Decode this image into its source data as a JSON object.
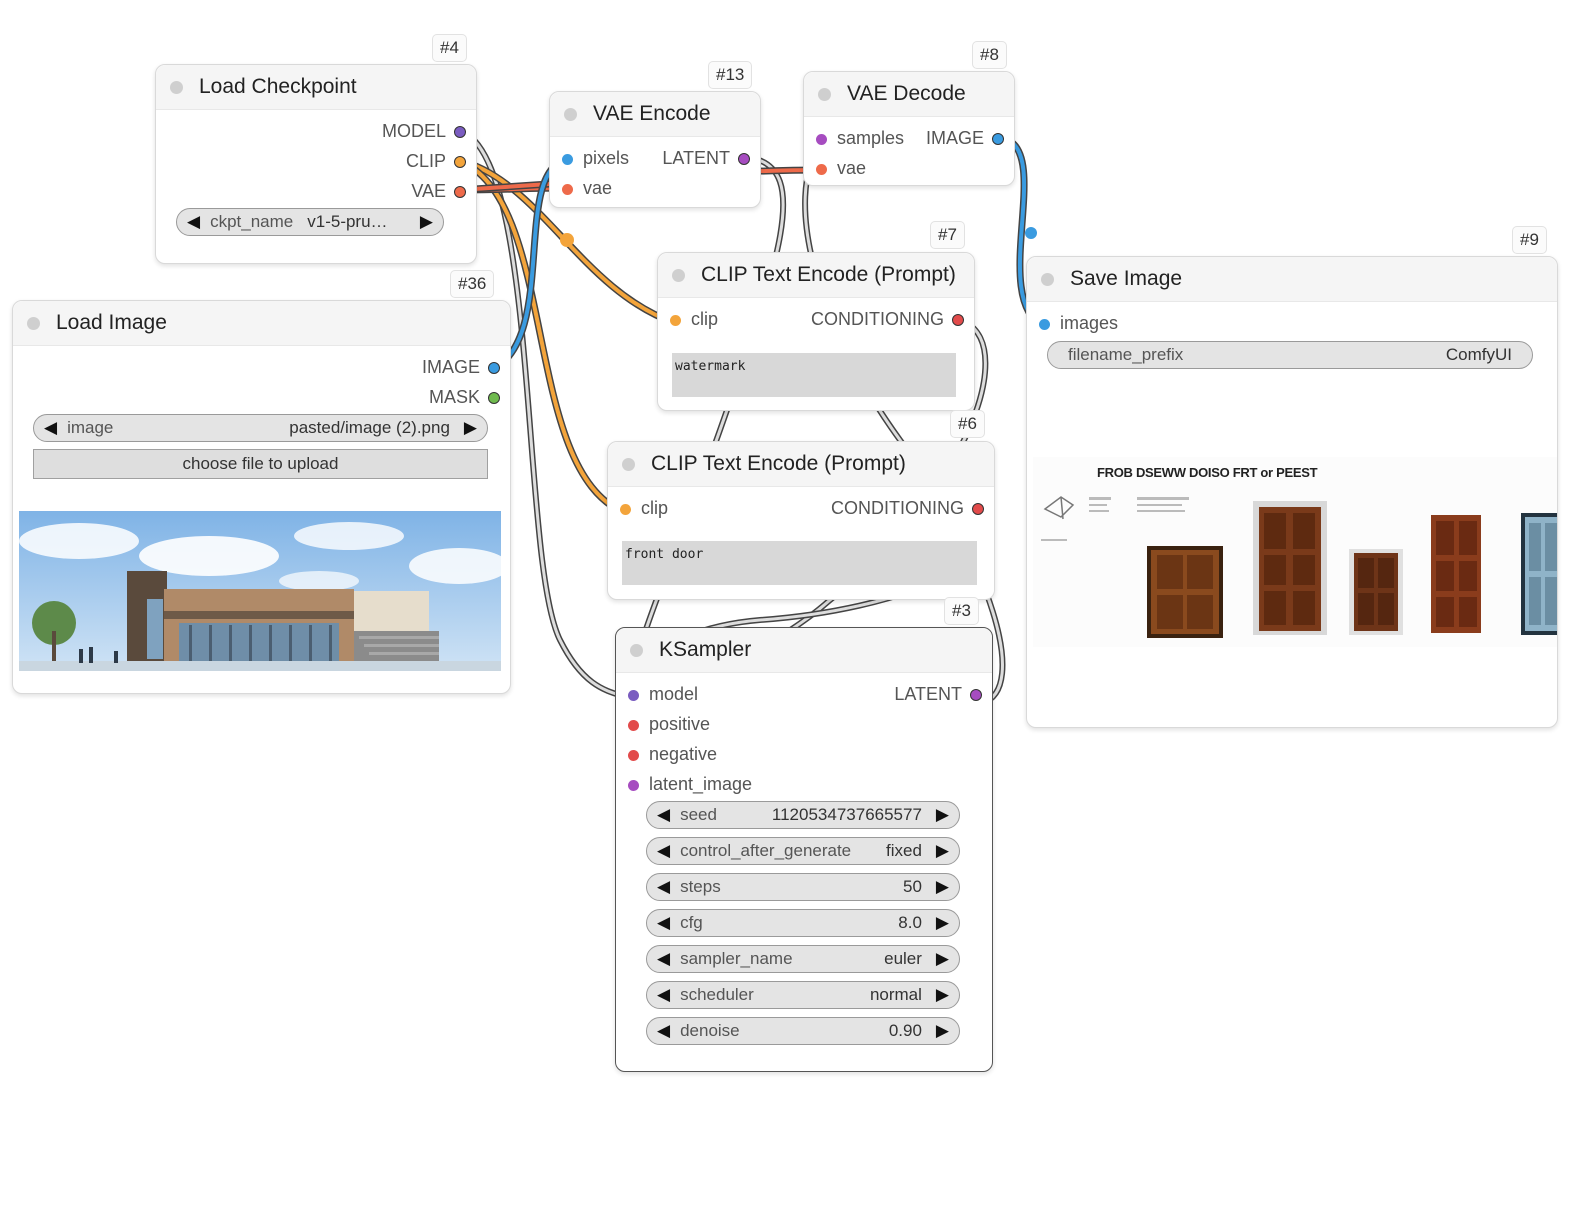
{
  "colors": {
    "model": "#7a5cc0",
    "clip": "#f3a43b",
    "vae": "#ee6a4a",
    "image": "#3a9be0",
    "mask": "#6fba4e",
    "latent": "#a64cc0",
    "conditioning": "#e24b4b"
  },
  "nodes": {
    "load_checkpoint": {
      "id": "#4",
      "title": "Load Checkpoint",
      "outputs": [
        "MODEL",
        "CLIP",
        "VAE"
      ],
      "widget": {
        "label": "ckpt_name",
        "value": "v1-5-pru…"
      }
    },
    "load_image": {
      "id": "#36",
      "title": "Load Image",
      "outputs": [
        "IMAGE",
        "MASK"
      ],
      "widget": {
        "label": "image",
        "value": "pasted/image (2).png"
      },
      "upload_button": "choose file to upload"
    },
    "vae_encode": {
      "id": "#13",
      "title": "VAE Encode",
      "inputs": [
        "pixels",
        "vae"
      ],
      "output": "LATENT"
    },
    "vae_decode": {
      "id": "#8",
      "title": "VAE Decode",
      "inputs": [
        "samples",
        "vae"
      ],
      "output": "IMAGE"
    },
    "clip_text_7": {
      "id": "#7",
      "title": "CLIP Text Encode (Prompt)",
      "input": "clip",
      "output": "CONDITIONING",
      "text": "watermark"
    },
    "clip_text_6": {
      "id": "#6",
      "title": "CLIP Text Encode (Prompt)",
      "input": "clip",
      "output": "CONDITIONING",
      "text": "front door"
    },
    "save_image": {
      "id": "#9",
      "title": "Save Image",
      "input": "images",
      "widget": {
        "label": "filename_prefix",
        "value": "ComfyUI"
      },
      "preview_heading": "FROB DSEWW DOISO FRT or PEEST"
    },
    "ksampler": {
      "id": "#3",
      "title": "KSampler",
      "inputs": [
        "model",
        "positive",
        "negative",
        "latent_image"
      ],
      "output": "LATENT",
      "widgets": [
        {
          "label": "seed",
          "value": "1120534737665577"
        },
        {
          "label": "control_after_generate",
          "value": "fixed"
        },
        {
          "label": "steps",
          "value": "50"
        },
        {
          "label": "cfg",
          "value": "8.0"
        },
        {
          "label": "sampler_name",
          "value": "euler"
        },
        {
          "label": "scheduler",
          "value": "normal"
        },
        {
          "label": "denoise",
          "value": "0.90"
        }
      ]
    }
  }
}
